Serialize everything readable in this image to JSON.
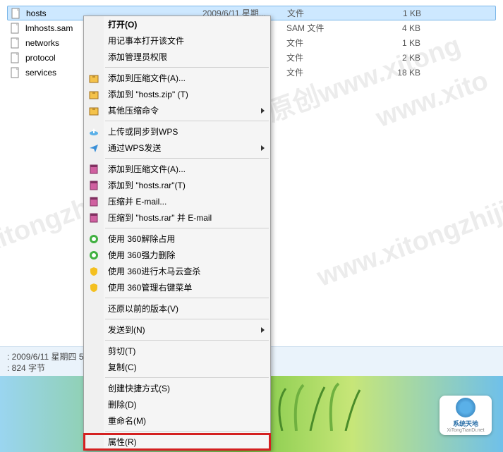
{
  "files": [
    {
      "name": "hosts",
      "date": "2009/6/11 星期...",
      "type": "文件",
      "size": "1 KB",
      "selected": true
    },
    {
      "name": "lmhosts.sam",
      "date": "",
      "type": "SAM 文件",
      "size": "4 KB",
      "selected": false
    },
    {
      "name": "networks",
      "date": "",
      "type": "文件",
      "size": "1 KB",
      "selected": false
    },
    {
      "name": "protocol",
      "date": "",
      "type": "文件",
      "size": "2 KB",
      "selected": false
    },
    {
      "name": "services",
      "date": "",
      "type": "文件",
      "size": "18 KB",
      "selected": false
    }
  ],
  "context_menu": {
    "open": "打开(O)",
    "open_notepad": "用记事本打开该文件",
    "add_admin": "添加管理员权限",
    "add_archive_a": "添加到压缩文件(A)...",
    "add_hosts_zip": "添加到 \"hosts.zip\" (T)",
    "other_archive": "其他压缩命令",
    "upload_wps": "上传或同步到WPS",
    "send_wps": "通过WPS发送",
    "add_archive_a2": "添加到压缩文件(A)...",
    "add_hosts_rar": "添加到 \"hosts.rar\"(T)",
    "compress_email": "压缩并 E-mail...",
    "compress_rar_email": "压缩到 \"hosts.rar\" 并 E-mail",
    "use_360_release": "使用 360解除占用",
    "use_360_force_del": "使用 360强力删除",
    "use_360_trojan": "使用 360进行木马云查杀",
    "use_360_manage": "使用 360管理右键菜单",
    "restore_prev": "还原以前的版本(V)",
    "send_to": "发送到(N)",
    "cut": "剪切(T)",
    "copy": "复制(C)",
    "create_shortcut": "创建快捷方式(S)",
    "delete": "删除(D)",
    "rename": "重命名(M)",
    "properties": "属性(R)"
  },
  "status": {
    "line1": ": 2009/6/11 星期四 5",
    "line2": ": 824 字节"
  },
  "badge": {
    "title": "系统天地",
    "url": "XiTongTianDi.net"
  },
  "watermarks": {
    "w1": "统之家原创www.xitong",
    "w2": ".xitongzhijia.net",
    "w3": "系统之家原创",
    "w4": "www.xito",
    "w5": "www.xitongzhijia.net"
  }
}
